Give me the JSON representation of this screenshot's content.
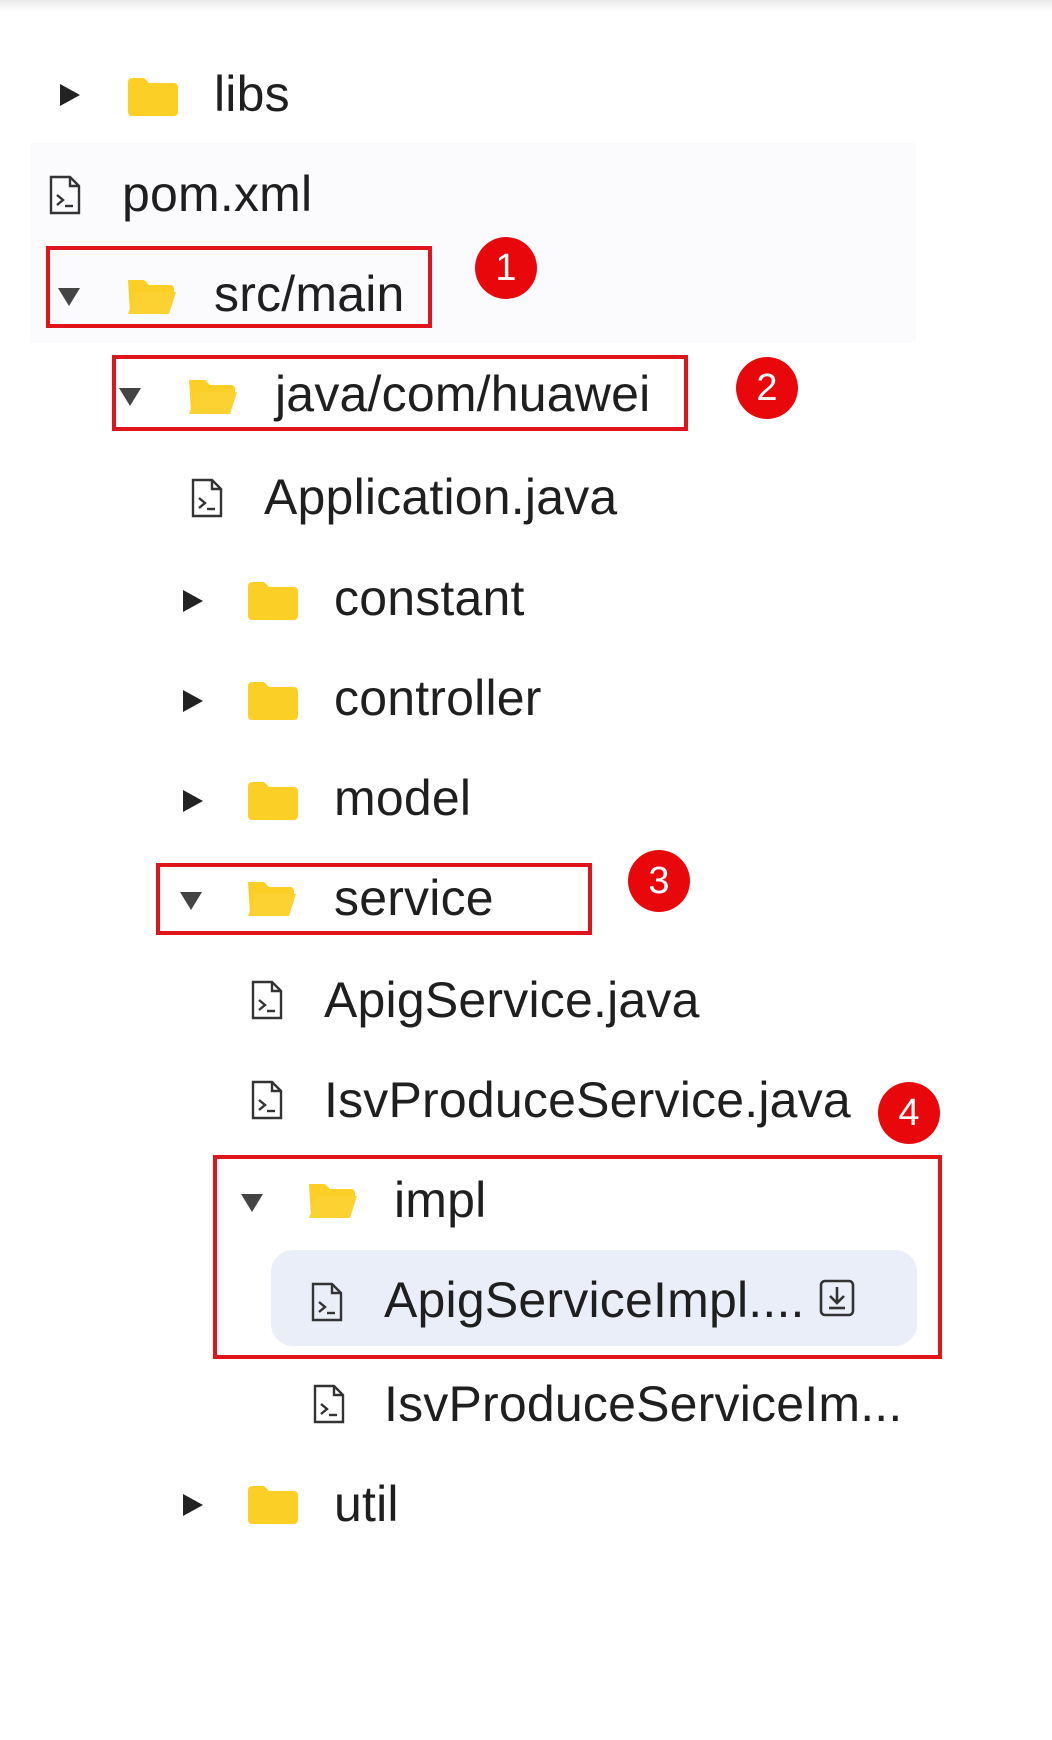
{
  "tree": {
    "items": [
      {
        "label": "libs",
        "type": "folder",
        "state": "collapsed"
      },
      {
        "label": "pom.xml",
        "type": "file"
      },
      {
        "label": "src/main",
        "type": "folder",
        "state": "expanded"
      },
      {
        "label": "java/com/huawei",
        "type": "folder",
        "state": "expanded"
      },
      {
        "label": "Application.java",
        "type": "file"
      },
      {
        "label": "constant",
        "type": "folder",
        "state": "collapsed"
      },
      {
        "label": "controller",
        "type": "folder",
        "state": "collapsed"
      },
      {
        "label": "model",
        "type": "folder",
        "state": "collapsed"
      },
      {
        "label": "service",
        "type": "folder",
        "state": "expanded"
      },
      {
        "label": "ApigService.java",
        "type": "file"
      },
      {
        "label": "IsvProduceService.java",
        "type": "file"
      },
      {
        "label": "impl",
        "type": "folder",
        "state": "expanded"
      },
      {
        "label": "ApigServiceImpl....",
        "type": "file",
        "selected": true
      },
      {
        "label": "IsvProduceServiceIm...",
        "type": "file"
      },
      {
        "label": "util",
        "type": "folder",
        "state": "collapsed"
      }
    ]
  },
  "annotations": [
    {
      "number": "1"
    },
    {
      "number": "2"
    },
    {
      "number": "3"
    },
    {
      "number": "4"
    }
  ],
  "colors": {
    "folder": "#fccf27",
    "annotation": "#e0141b",
    "selection": "#eaeef8"
  },
  "icons": {
    "folder_closed": "folder-icon",
    "folder_open": "folder-open-icon",
    "file": "code-file-icon",
    "download": "download-icon"
  }
}
